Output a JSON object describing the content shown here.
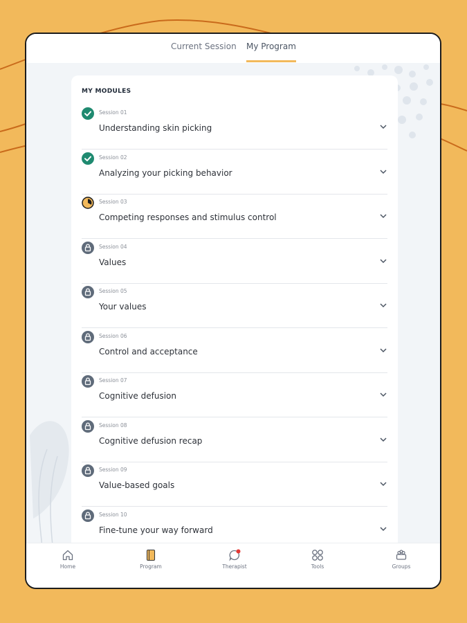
{
  "tabs": [
    {
      "label": "Current Session"
    },
    {
      "label": "My Program",
      "active": true
    }
  ],
  "section_title": "MY MODULES",
  "modules": [
    {
      "session": "Session 01",
      "title": "Understanding skin picking",
      "status": "completed"
    },
    {
      "session": "Session 02",
      "title": "Analyzing your picking behavior",
      "status": "completed"
    },
    {
      "session": "Session 03",
      "title": "Competing responses and stimulus control",
      "status": "in-progress"
    },
    {
      "session": "Session 04",
      "title": "Values",
      "status": "locked"
    },
    {
      "session": "Session 05",
      "title": "Your values",
      "status": "locked"
    },
    {
      "session": "Session 06",
      "title": "Control and acceptance",
      "status": "locked"
    },
    {
      "session": "Session 07",
      "title": "Cognitive defusion",
      "status": "locked"
    },
    {
      "session": "Session 08",
      "title": "Cognitive defusion recap",
      "status": "locked"
    },
    {
      "session": "Session 09",
      "title": "Value-based goals",
      "status": "locked"
    },
    {
      "session": "Session 10",
      "title": "Fine-tune your way forward",
      "status": "locked"
    }
  ],
  "nav": [
    {
      "label": "Home",
      "icon": "home-icon"
    },
    {
      "label": "Program",
      "icon": "book-icon",
      "active": true
    },
    {
      "label": "Therapist",
      "icon": "chat-icon",
      "badge": true
    },
    {
      "label": "Tools",
      "icon": "tools-icon"
    },
    {
      "label": "Groups",
      "icon": "groups-icon"
    }
  ],
  "colors": {
    "background": "#F2B95B",
    "completed": "#1F8A70",
    "locked": "#5F6B7A",
    "in_progress": "#F2B95B",
    "accent_line": "#C96A1B",
    "badge": "#E53935"
  }
}
